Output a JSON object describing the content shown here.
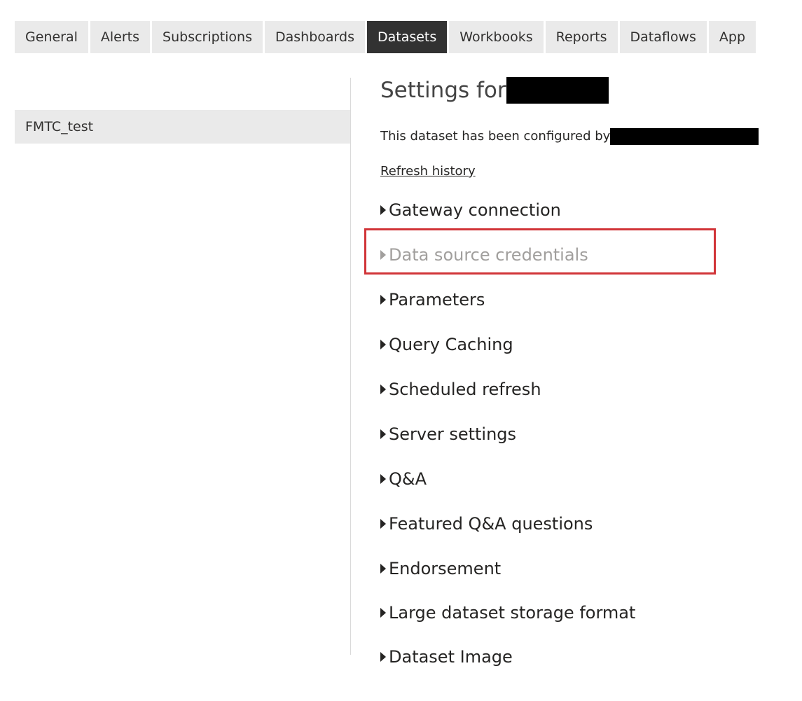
{
  "tabs": [
    {
      "label": "General",
      "active": false
    },
    {
      "label": "Alerts",
      "active": false
    },
    {
      "label": "Subscriptions",
      "active": false
    },
    {
      "label": "Dashboards",
      "active": false
    },
    {
      "label": "Datasets",
      "active": true
    },
    {
      "label": "Workbooks",
      "active": false
    },
    {
      "label": "Reports",
      "active": false
    },
    {
      "label": "Dataflows",
      "active": false
    },
    {
      "label": "App",
      "active": false
    }
  ],
  "datasets": [
    {
      "label": "FMTC_test",
      "selected": true
    }
  ],
  "settings": {
    "title_prefix": "Settings for",
    "configured_by_text": "This dataset has been configured by",
    "refresh_history_link": "Refresh history",
    "sections": [
      {
        "label": "Gateway connection",
        "enabled": true
      },
      {
        "label": "Data source credentials",
        "enabled": false,
        "highlighted": true
      },
      {
        "label": "Parameters",
        "enabled": true
      },
      {
        "label": "Query Caching",
        "enabled": true
      },
      {
        "label": "Scheduled refresh",
        "enabled": true
      },
      {
        "label": "Server settings",
        "enabled": true
      },
      {
        "label": "Q&A",
        "enabled": true
      },
      {
        "label": "Featured Q&A questions",
        "enabled": true
      },
      {
        "label": "Endorsement",
        "enabled": true
      },
      {
        "label": "Large dataset storage format",
        "enabled": true
      },
      {
        "label": "Dataset Image",
        "enabled": true
      }
    ]
  },
  "colors": {
    "active_tab_bg": "#323232",
    "tab_bg": "#eaeaea",
    "highlight_border": "#d13438",
    "disabled_text": "#a19f9d"
  }
}
